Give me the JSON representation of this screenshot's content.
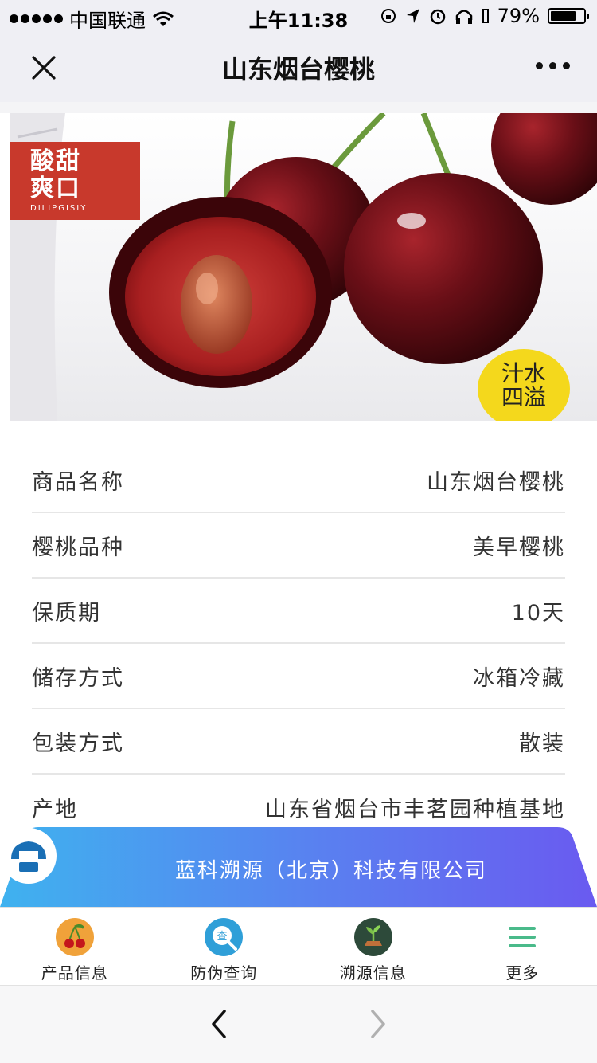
{
  "status_bar": {
    "carrier": "中国联通",
    "time": "上午11:38",
    "battery_percent": "79%",
    "battery_level": 0.79
  },
  "nav": {
    "title": "山东烟台樱桃",
    "close_icon": "close-icon",
    "more_icon": "more-dots-icon"
  },
  "banner": {
    "tag_red_line1": "酸甜",
    "tag_red_line2": "爽口",
    "tag_red_sub": "DILIPGISIY",
    "tag_yellow_line1": "汁水",
    "tag_yellow_line2": "四溢",
    "colors": {
      "tag_red": "#c8392c",
      "tag_yellow": "#f4d81c",
      "cherry": "#5a0d12"
    }
  },
  "info_rows": [
    {
      "key": "商品名称",
      "value": "山东烟台樱桃"
    },
    {
      "key": "樱桃品种",
      "value": "美早樱桃"
    },
    {
      "key": "保质期",
      "value": "10天"
    },
    {
      "key": "储存方式",
      "value": "冰箱冷藏"
    },
    {
      "key": "包装方式",
      "value": "散装"
    },
    {
      "key": "产地",
      "value": "山东省烟台市丰茗园种植基地"
    }
  ],
  "company": {
    "name": "蓝科溯源（北京）科技有限公司",
    "gradient": [
      "#3fb2ef",
      "#6a5af0"
    ]
  },
  "tabs": [
    {
      "label": "产品信息",
      "icon": "cherry-icon"
    },
    {
      "label": "防伪查询",
      "icon": "search-query-icon"
    },
    {
      "label": "溯源信息",
      "icon": "sprout-icon"
    },
    {
      "label": "更多",
      "icon": "menu-icon"
    }
  ],
  "browser": {
    "back_icon": "chevron-left-icon",
    "forward_icon": "chevron-right-icon"
  }
}
